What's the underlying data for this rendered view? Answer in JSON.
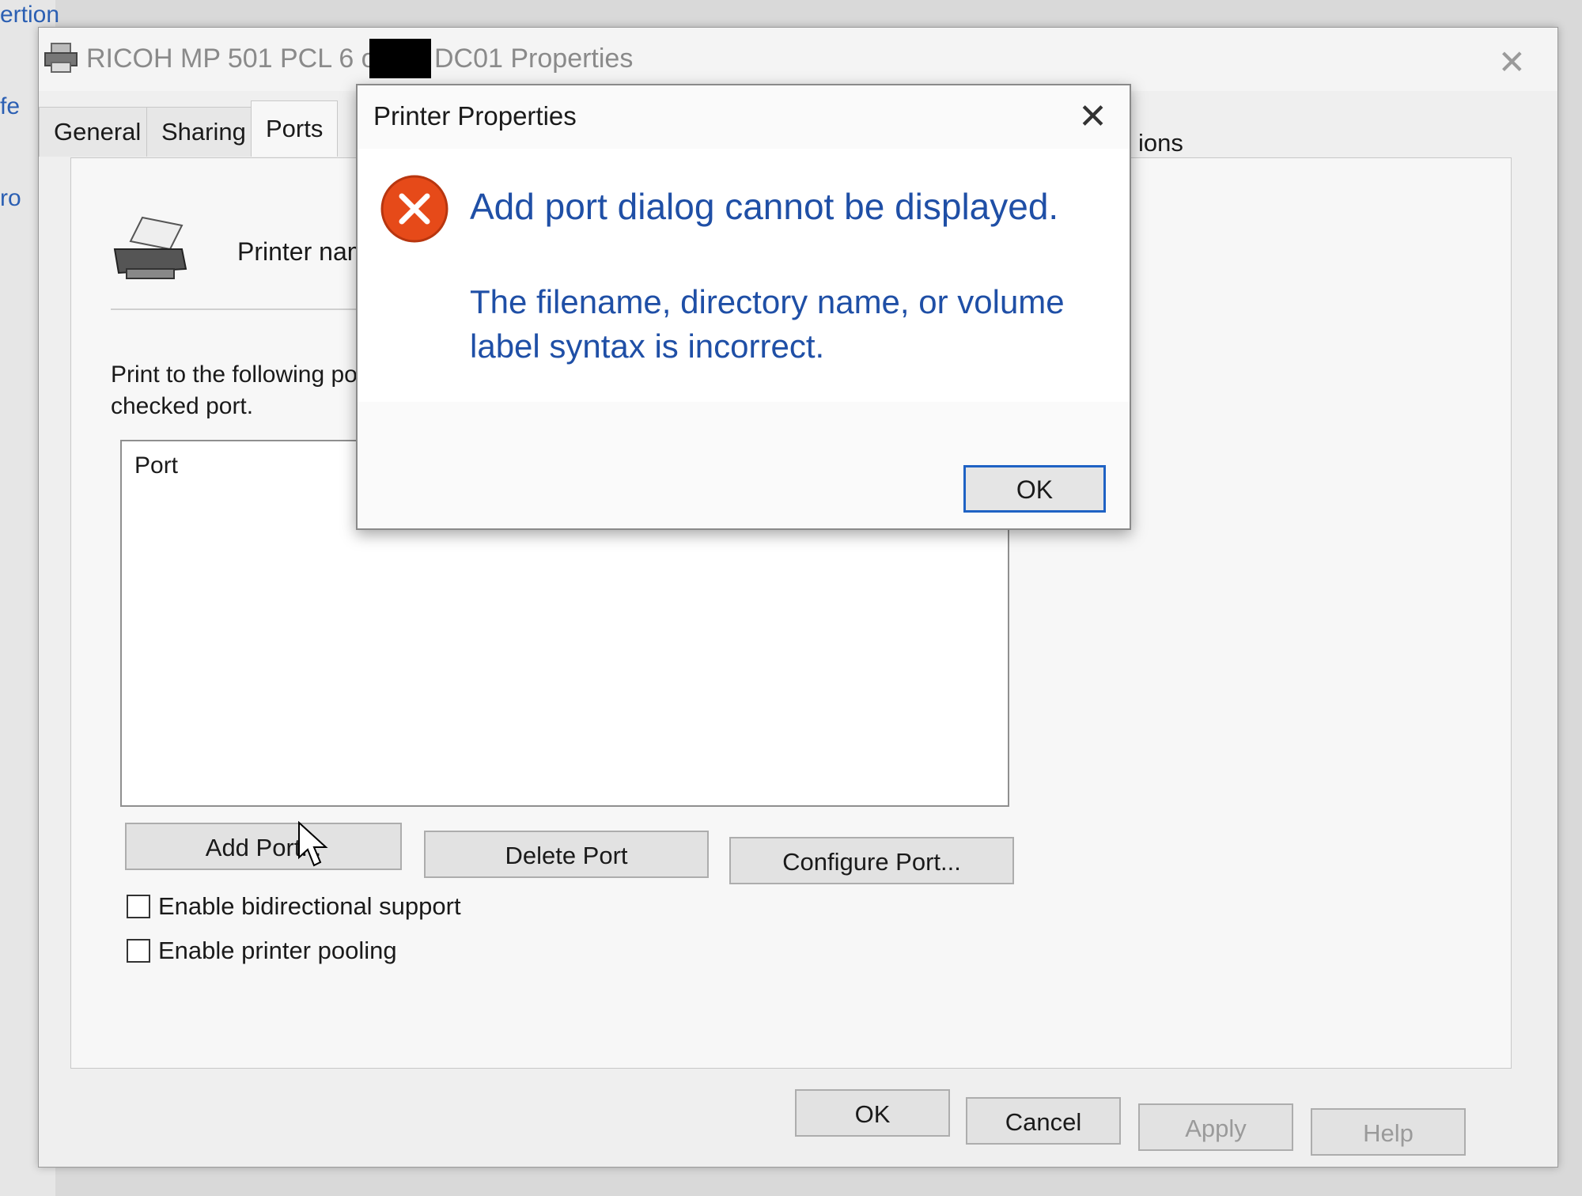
{
  "background": {
    "left_edge_fragments": [
      "ertion",
      "fe",
      "ro"
    ]
  },
  "main_window": {
    "title_prefix": "RICOH MP 501 PCL 6 on",
    "title_suffix": "DC01 Properties",
    "close_glyph": "✕",
    "tabs": [
      {
        "label": "General"
      },
      {
        "label": "Sharing"
      },
      {
        "label": "Ports"
      }
    ],
    "tab_fragment": "ions",
    "selected_tab": "Ports",
    "ports_panel": {
      "printer_name_label": "Printer name",
      "print_to_text": "Print to the following po",
      "print_to_text2": "checked port.",
      "port_column_header": "Port",
      "buttons": {
        "add_port": "Add Port...",
        "delete_port": "Delete Port",
        "configure_port": "Configure Port..."
      },
      "checkboxes": {
        "bidirectional": {
          "label": "Enable bidirectional support",
          "checked": false
        },
        "pooling": {
          "label": "Enable printer pooling",
          "checked": false
        }
      }
    },
    "footer_buttons": {
      "ok": "OK",
      "cancel": "Cancel",
      "apply": "Apply",
      "help": "Help"
    }
  },
  "error_dialog": {
    "title": "Printer Properties",
    "close_glyph": "✕",
    "icon": "error-icon",
    "message_main": "Add port dialog cannot be displayed.",
    "message_detail": "The filename, directory name, or volume label syntax is incorrect.",
    "ok_label": "OK",
    "accent_color": "#1f4fa6",
    "error_color": "#e64a19"
  }
}
